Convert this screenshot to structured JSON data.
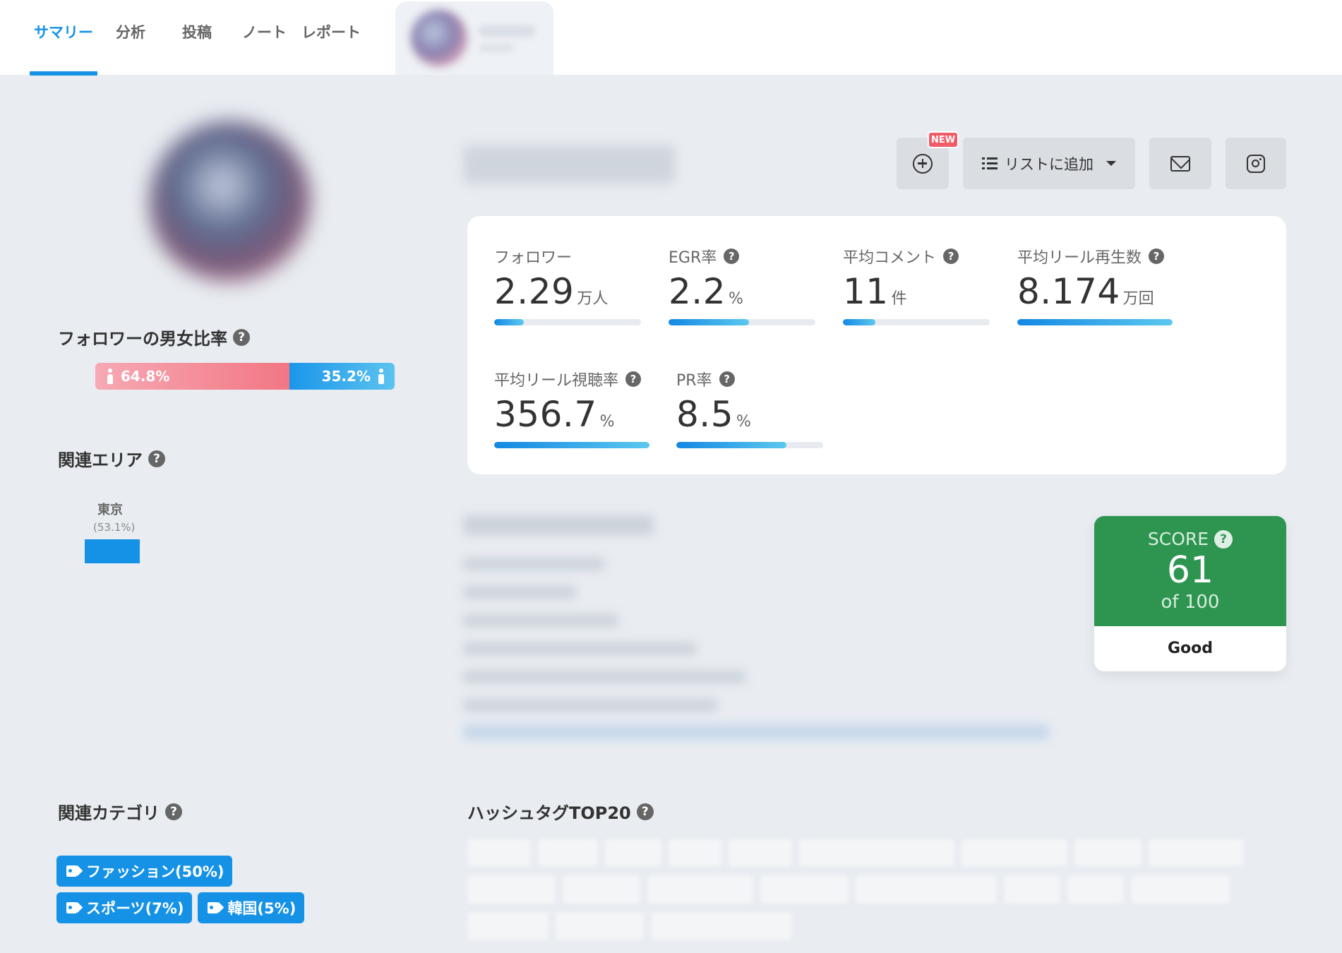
{
  "nav": {
    "tabs": [
      {
        "label": "サマリー",
        "active": true
      },
      {
        "label": "分析"
      },
      {
        "label": "投稿"
      },
      {
        "label": "ノート"
      },
      {
        "label": "レポート"
      }
    ]
  },
  "left": {
    "gender_title": "フォロワーの男女比率",
    "gender": {
      "female_pct": 64.8,
      "female_label": "64.8%",
      "male_pct": 35.2,
      "male_label": "35.2%"
    },
    "area_title": "関連エリア",
    "area": {
      "name": "東京",
      "pct_label": "(53.1%)"
    },
    "category_title": "関連カテゴリ",
    "categories": [
      "ファッション(50%)",
      "スポーツ(7%)",
      "韓国(5%)"
    ]
  },
  "actions": {
    "new_badge": "NEW",
    "list_add_label": "リストに追加"
  },
  "stats": [
    {
      "label": "フォロワー",
      "value": "2.29",
      "unit": "万人",
      "help": false,
      "fill_pct": 20
    },
    {
      "label": "EGR率",
      "value": "2.2",
      "unit": "%",
      "help": true,
      "fill_pct": 55
    },
    {
      "label": "平均コメント",
      "value": "11",
      "unit": "件",
      "help": true,
      "fill_pct": 22
    },
    {
      "label": "平均リール再生数",
      "value": "8.174",
      "unit": "万回",
      "help": true,
      "fill_pct": 100
    },
    {
      "label": "平均リール視聴率",
      "value": "356.7",
      "unit": "%",
      "help": true,
      "fill_pct": 100
    },
    {
      "label": "PR率",
      "value": "8.5",
      "unit": "%",
      "help": true,
      "fill_pct": 75
    }
  ],
  "score": {
    "label": "SCORE",
    "value": "61",
    "of_label": "of 100",
    "rating": "Good",
    "color": "#2e9551"
  },
  "hashtags_title": "ハッシュタグTOP20",
  "colors": {
    "accent": "#1592e6",
    "female": "#f27784",
    "male": "#1b96ea",
    "new_badge": "#ef5b66"
  }
}
